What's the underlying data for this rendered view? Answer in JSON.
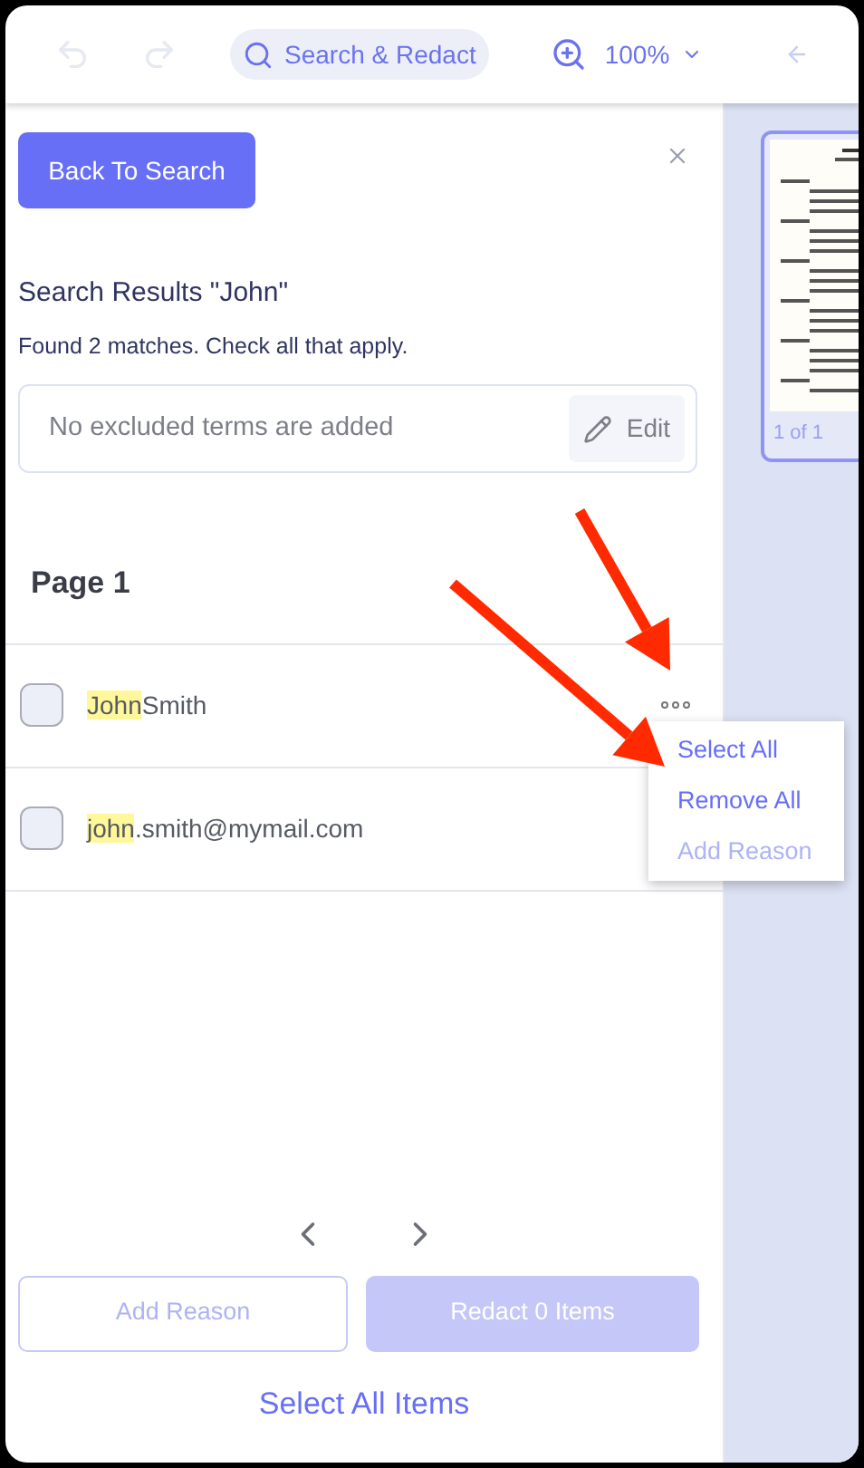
{
  "toolbar": {
    "undo_disabled": true,
    "redo_disabled": true,
    "search_label": "Search & Redact",
    "zoom": "100%"
  },
  "panel": {
    "back_button": "Back To Search",
    "title": "Search Results \"John\"",
    "subtitle": "Found 2 matches. Check all that apply.",
    "excluded_placeholder": "No excluded terms are added",
    "edit_button": "Edit",
    "page_heading": "Page 1"
  },
  "matches": [
    {
      "highlight": "John",
      "rest": "Smith",
      "checked": false
    },
    {
      "highlight": "john",
      "rest": ".smith@mymail.com",
      "checked": false
    }
  ],
  "menu": [
    {
      "label": "Select All",
      "disabled": false
    },
    {
      "label": "Remove All",
      "disabled": false
    },
    {
      "label": "Add Reason",
      "disabled": true
    }
  ],
  "footer": {
    "add_reason": "Add Reason",
    "add_reason_disabled": true,
    "redact": "Redact 0 Items",
    "redact_disabled": true,
    "select_all": "Select All Items"
  },
  "thumbnail": {
    "label": "1 of 1",
    "selected": true
  }
}
